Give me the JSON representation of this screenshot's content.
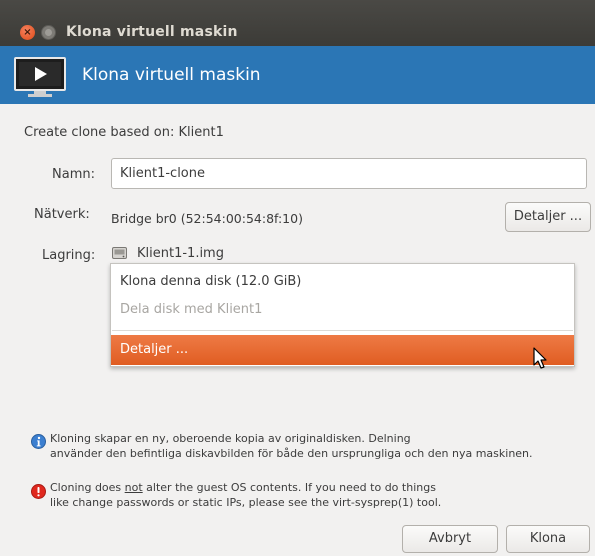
{
  "window": {
    "title": "Klona virtuell maskin",
    "close_glyph": "×"
  },
  "banner": {
    "title": "Klona virtuell maskin",
    "icon": "monitor-play-icon"
  },
  "form": {
    "clone_based_on": "Create clone based on: Klient1",
    "name_label": "Namn:",
    "name_value": "Klient1-clone",
    "network_label": "Nätverk:",
    "network_value": "Bridge br0 (52:54:00:54:8f:10)",
    "network_details_button": "Detaljer ...",
    "storage_label": "Lagring:",
    "storage_value": "Klient1-1.img"
  },
  "storage_menu": {
    "items": [
      {
        "label": "Klona denna disk (12.0 GiB)",
        "enabled": true
      },
      {
        "label": "Dela disk med Klient1",
        "enabled": false
      },
      {
        "label": "Detaljer ...",
        "enabled": true,
        "highlighted": true
      }
    ]
  },
  "notes": {
    "info_line1": "Kloning skapar en ny, oberoende kopia av originaldisken. Delning",
    "info_line2": "använder den befintliga diskavbilden för både den ursprungliga och den nya maskinen.",
    "warn_pre": "Cloning does ",
    "warn_emph": "not",
    "warn_post": " alter the guest OS contents. If you need to do things",
    "warn_line2": "like change passwords or static IPs, please see the virt-sysprep(1) tool."
  },
  "buttons": {
    "cancel": "Avbryt",
    "clone": "Klona"
  },
  "colors": {
    "banner": "#2b76b5",
    "highlight": "#e05d22",
    "titlebar": "#3c3b37"
  }
}
